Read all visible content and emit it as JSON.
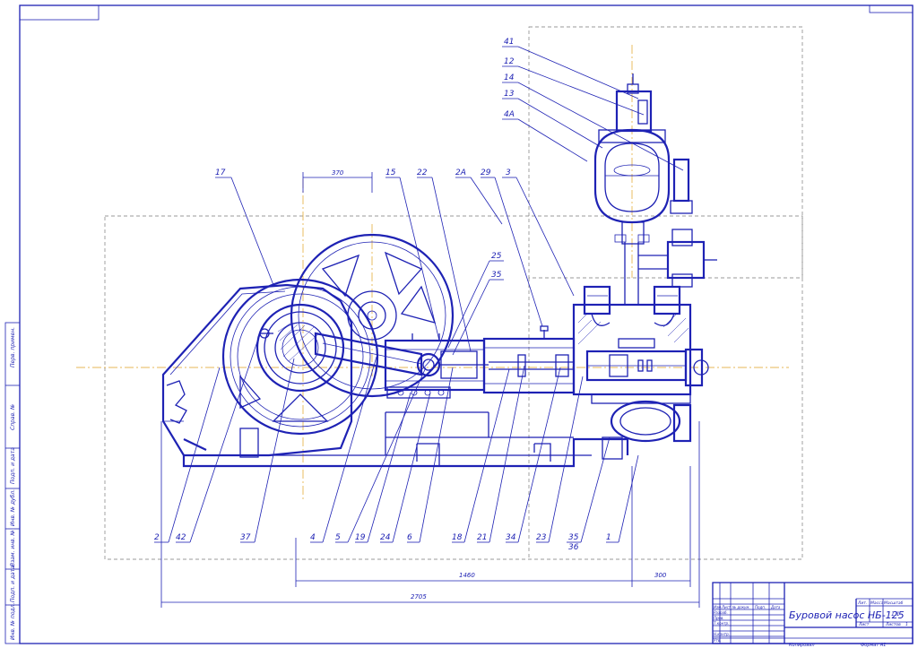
{
  "title_block": {
    "title": "Буровой насос НБ-125",
    "lit_header": "Лит.",
    "mass_header": "Масса",
    "scale_header": "Масштаб",
    "scale_value": "1:1",
    "sheet_label": "Лист",
    "sheets_label": "Листов",
    "sheets_value": "1",
    "rows": [
      "Изм.",
      "Лист",
      "№ докум.",
      "Подп.",
      "Дата"
    ],
    "roles": [
      "Разраб.",
      "Пров.",
      "Т.контр.",
      "Н.контр.",
      "Утв."
    ],
    "copied": "Копировал",
    "format": "Формат  А1"
  },
  "side_stamp": [
    "Перв. примен.",
    "Справ. №",
    "Подп. и дата",
    "Инв. № дубл.",
    "Взам. инв. №",
    "Подп. и дата",
    "Инв. № подл."
  ],
  "dimensions": {
    "top_370": "370",
    "bottom_1460": "1460",
    "bottom_300": "300",
    "bottom_2705": "2705"
  },
  "callouts_top": [
    "17",
    "15",
    "22",
    "2А",
    "29",
    "3",
    "25",
    "35",
    "41",
    "12",
    "14",
    "13",
    "4А"
  ],
  "callouts_bottom": [
    "2",
    "42",
    "37",
    "4",
    "5",
    "19",
    "24",
    "6",
    "18",
    "21",
    "34",
    "23",
    "35",
    "36",
    "1"
  ],
  "colors": {
    "line": "#1e22b4",
    "axis": "#e0a020",
    "frame_dash": "#7a7a7a"
  }
}
